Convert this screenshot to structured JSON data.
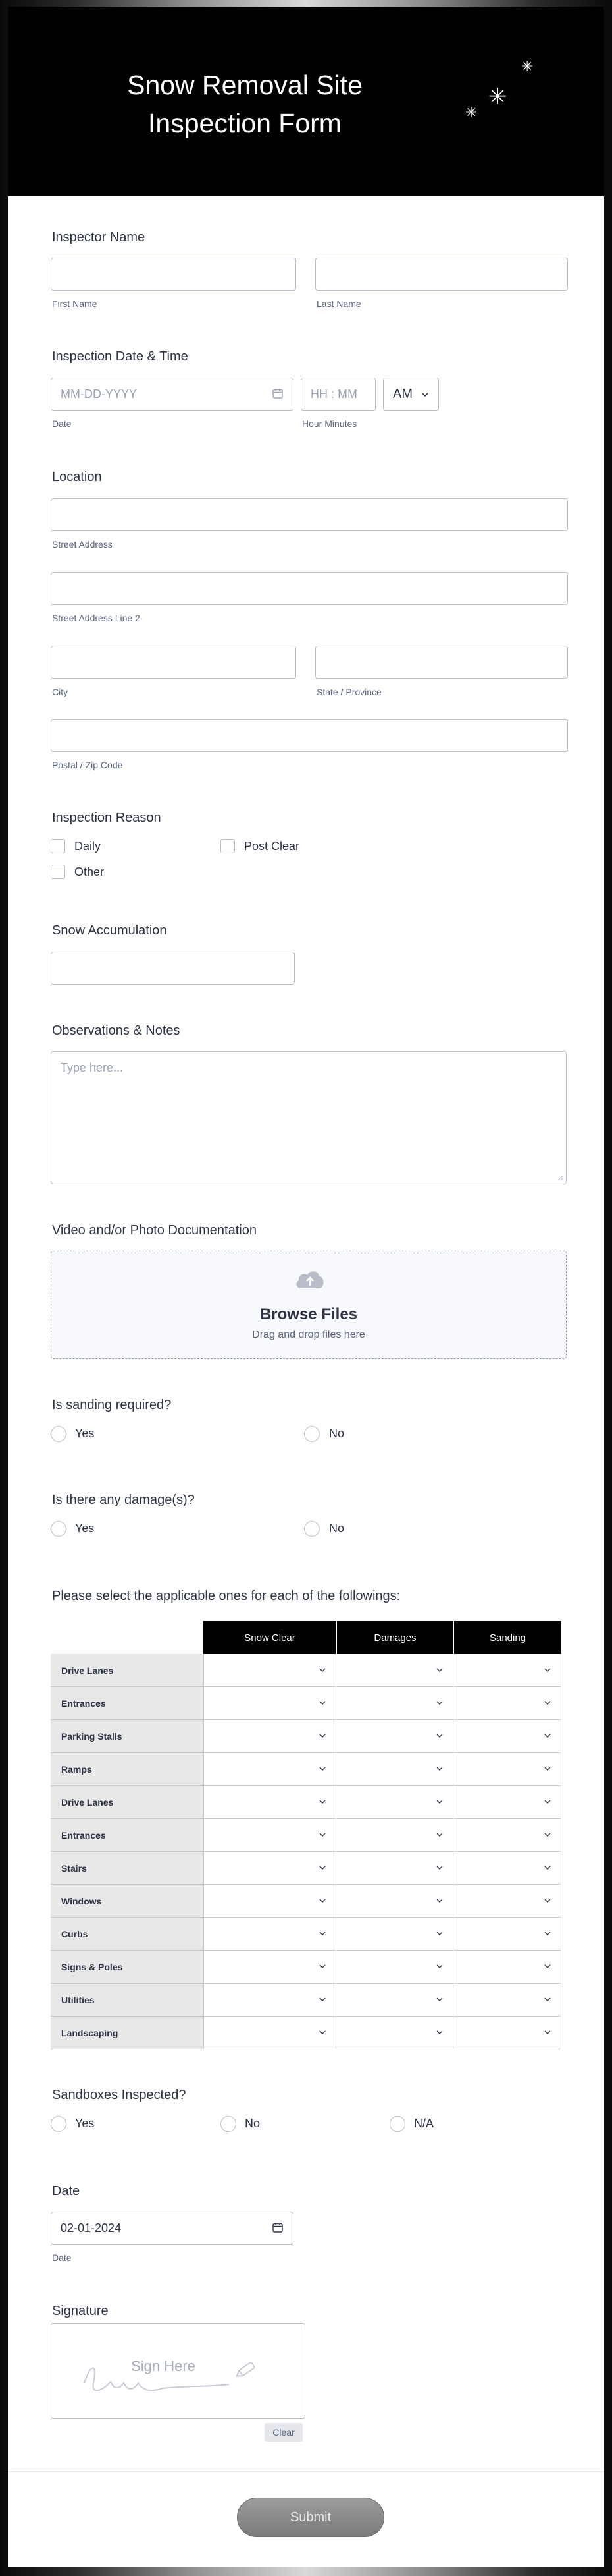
{
  "form": {
    "title_line1": "Snow Removal Site",
    "title_line2": "Inspection Form"
  },
  "inspector": {
    "label": "Inspector Name",
    "first_label": "First Name",
    "last_label": "Last Name",
    "first_value": "",
    "last_value": ""
  },
  "datetime": {
    "label": "Inspection Date & Time",
    "date_placeholder": "MM-DD-YYYY",
    "time_placeholder": "HH : MM",
    "ampm_value": "AM",
    "date_sublabel": "Date",
    "time_sublabel": "Hour Minutes"
  },
  "location": {
    "label": "Location",
    "street_label": "Street Address",
    "street2_label": "Street Address Line 2",
    "city_label": "City",
    "state_label": "State / Province",
    "zip_label": "Postal / Zip Code"
  },
  "reason": {
    "label": "Inspection Reason",
    "options": [
      "Daily",
      "Post Clear",
      "Other"
    ]
  },
  "snow": {
    "label": "Snow Accumulation"
  },
  "notes": {
    "label": "Observations & Notes",
    "placeholder": "Type here..."
  },
  "upload": {
    "label": "Video and/or Photo Documentation",
    "browse": "Browse Files",
    "drag": "Drag and drop files here"
  },
  "sanding": {
    "label": "Is sanding required?",
    "options": [
      "Yes",
      "No"
    ]
  },
  "damage": {
    "label": "Is there any damage(s)?",
    "options": [
      "Yes",
      "No"
    ]
  },
  "matrix": {
    "label": "Please select the applicable ones for each of the followings:",
    "columns": [
      "Snow Clear",
      "Damages",
      "Sanding"
    ],
    "rows": [
      "Drive Lanes",
      "Entrances",
      "Parking Stalls",
      "Ramps",
      "Drive Lanes",
      "Entrances",
      "Stairs",
      "Windows",
      "Curbs",
      "Signs & Poles",
      "Utilities",
      "Landscaping"
    ]
  },
  "sandboxes": {
    "label": "Sandboxes Inspected?",
    "options": [
      "Yes",
      "No",
      "N/A"
    ]
  },
  "date_field": {
    "label": "Date",
    "value": "02-01-2024",
    "sublabel": "Date"
  },
  "signature": {
    "label": "Signature",
    "placeholder": "Sign Here",
    "clear": "Clear"
  },
  "submit": {
    "label": "Submit"
  },
  "colors": {
    "header_bg": "#000000",
    "submit_bg": "#8a8a8a"
  }
}
